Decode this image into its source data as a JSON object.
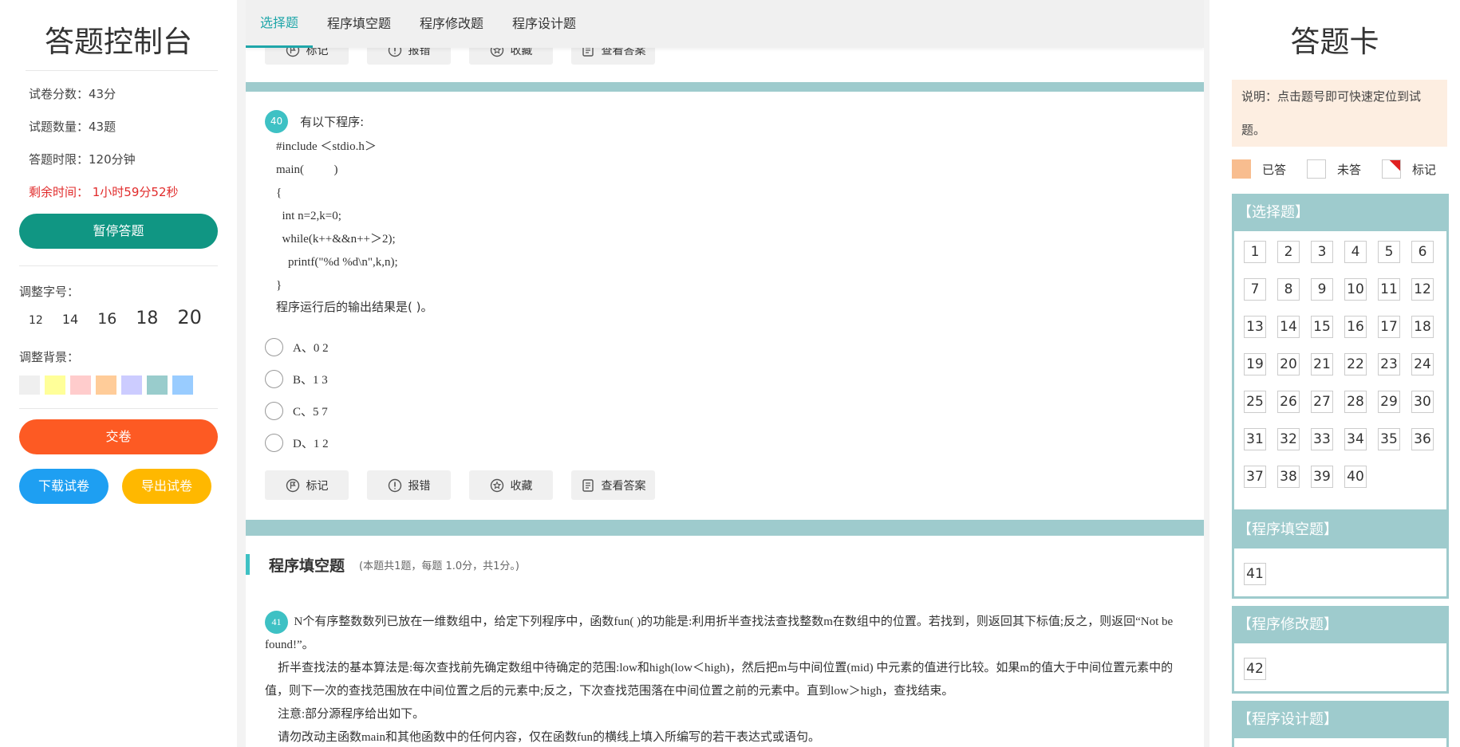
{
  "left": {
    "title": "答题控制台",
    "score": "试卷分数：43分",
    "count": "试题数量：43题",
    "time_limit": "答题时限：120分钟",
    "remaining": "剩余时间： 1小时59分52秒",
    "pause_label": "暂停答题",
    "font_label": "调整字号：",
    "font_sizes": [
      "12",
      "14",
      "16",
      "18",
      "20"
    ],
    "bg_label": "调整背景：",
    "bg_colors": [
      "#efefef",
      "#ffff99",
      "#ffcccc",
      "#ffcc99",
      "#ccccff",
      "#99cccc",
      "#99ccff"
    ],
    "submit_label": "交卷",
    "download_label": "下载试卷",
    "export_label": "导出试卷"
  },
  "tabs": [
    "选择题",
    "程序填空题",
    "程序修改题",
    "程序设计题"
  ],
  "actions": [
    "标记",
    "报错",
    "收藏",
    "查看答案"
  ],
  "q40": {
    "num": "40",
    "text": "有以下程序:",
    "code": [
      "#include ＜stdio.h＞",
      "main(          )",
      "{",
      "  int n=2,k=0;",
      "  while(k++&&n++＞2);",
      "    printf(\"%d %d\\n\",k,n);",
      "}"
    ],
    "tail": "程序运行后的输出结果是(          )。",
    "options": [
      "A、0 2",
      "B、1 3",
      "C、5 7",
      "D、1 2"
    ]
  },
  "section2": {
    "name": "程序填空题",
    "desc": "(本题共1题，每题 1.0分，共1分。)"
  },
  "q41": {
    "num": "41",
    "lines": [
      "N个有序整数数列已放在一维数组中，给定下列程序中，函数fun(          )的功能是:利用折半查找法查找整数m在数组中的位置。若找到，则返回其下标值;反之，则返回“Not be found!”。",
      "折半查找法的基本算法是:每次查找前先确定数组中待确定的范围:low和high(low＜high)，然后把m与中间位置(mid) 中元素的值进行比较。如果m的值大于中间位置元素中的值，则下一次的查找范围放在中间位置之后的元素中;反之，下次查找范围落在中间位置之前的元素中。直到low＞high，查找结束。",
      "注意:部分源程序给出如下。",
      "请勿改动主函数main和其他函数中的任何内容，仅在函数fun的横线上填入所编写的若干表达式或语句。"
    ]
  },
  "right": {
    "title": "答题卡",
    "note": "说明：点击题号即可快速定位到试题。",
    "legend": [
      "已答",
      "未答",
      "标记"
    ],
    "choice_head": "【选择题】",
    "choice_nums": [
      "1",
      "2",
      "3",
      "4",
      "5",
      "6",
      "7",
      "8",
      "9",
      "10",
      "11",
      "12",
      "13",
      "14",
      "15",
      "16",
      "17",
      "18",
      "19",
      "20",
      "21",
      "22",
      "23",
      "24",
      "25",
      "26",
      "27",
      "28",
      "29",
      "30",
      "31",
      "32",
      "33",
      "34",
      "35",
      "36",
      "37",
      "38",
      "39",
      "40"
    ],
    "fill_head": "【程序填空题】",
    "fill_nums": [
      "41"
    ],
    "modify_head": "【程序修改题】",
    "modify_nums": [
      "42"
    ],
    "design_head": "【程序设计题】"
  }
}
